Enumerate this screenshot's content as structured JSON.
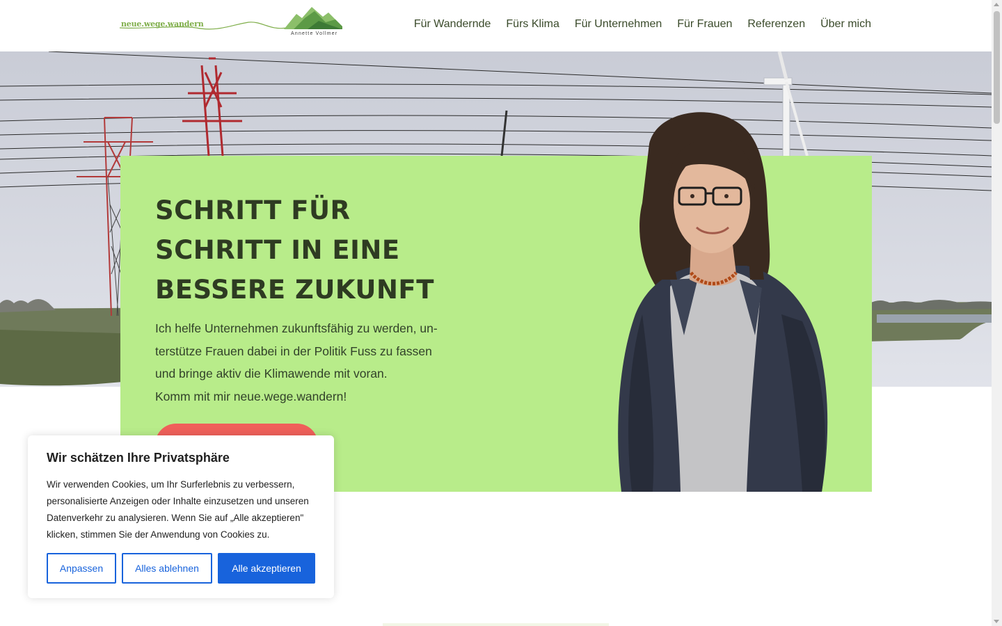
{
  "header": {
    "logo_text": "neue.wege.wandern",
    "logo_author": "Annette Vollmer",
    "nav": [
      {
        "label": "Für Wandernde"
      },
      {
        "label": "Fürs Klima"
      },
      {
        "label": "Für Unternehmen"
      },
      {
        "label": "Für Frauen"
      },
      {
        "label": "Referenzen"
      },
      {
        "label": "Über mich"
      }
    ]
  },
  "hero": {
    "title": "SCHRITT FÜR\nSCHRITT IN EINE\nBESSERE ZUKUNFT",
    "text_lines": [
      "Ich helfe Unternehmen zukunftsfähig zu werden, un-",
      "terstütze Frauen dabei in der Politik Fuss zu fassen",
      "und bringe aktiv die Klimawende mit voran.",
      "Komm mit mir neue.wege.wandern!"
    ],
    "card_color": "#b8ec8a",
    "cta_color": "#f0605a"
  },
  "cookie": {
    "title": "Wir schätzen Ihre Privatsphäre",
    "text": "Wir verwenden Cookies, um Ihr Surferlebnis zu verbessern, personalisierte Anzeigen oder Inhalte einzusetzen und unseren Datenverkehr zu analysieren. Wenn Sie auf „Alle akzeptieren\" klicken, stimmen Sie der Anwendung von Cookies zu.",
    "buttons": {
      "customize": "Anpassen",
      "reject": "Alles ablehnen",
      "accept": "Alle akzeptieren"
    },
    "accent_color": "#1863dc"
  }
}
